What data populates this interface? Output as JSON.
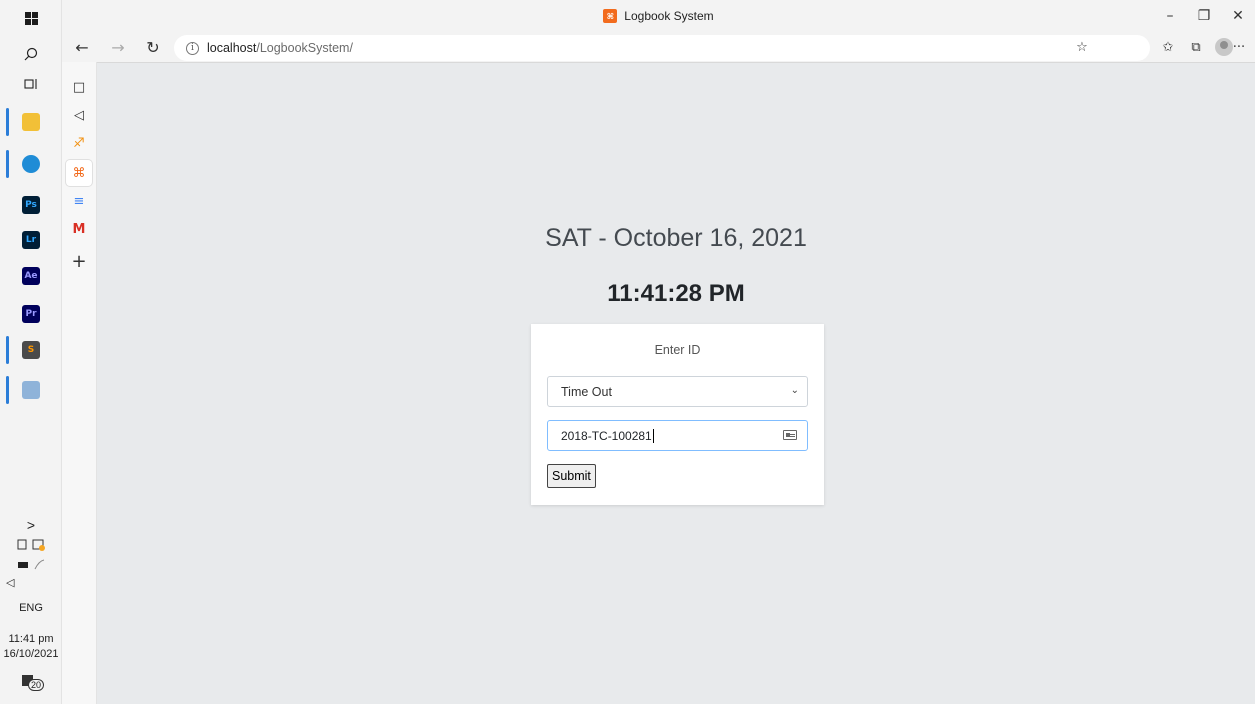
{
  "window": {
    "title": "Logbook System",
    "favicon_glyph": "⌘",
    "controls": {
      "minimize": "–",
      "restore": "❐",
      "close": "✕"
    }
  },
  "toolbar": {
    "back": "←",
    "forward": "→",
    "reload": "↻",
    "url_host": "localhost",
    "url_path": "/LogbookSystem/",
    "info": "i",
    "favorites_add": "☆",
    "favorites": "✩",
    "collections": "⧉",
    "more": "···"
  },
  "sidebar": {
    "items": [
      {
        "name": "tab-actions",
        "glyph": "□"
      },
      {
        "name": "speaker",
        "glyph": "◁"
      },
      {
        "name": "pma",
        "glyph": "♐"
      },
      {
        "name": "xampp",
        "glyph": "⌘"
      },
      {
        "name": "docs",
        "glyph": "≡"
      },
      {
        "name": "gmail",
        "glyph": "M"
      },
      {
        "name": "add",
        "glyph": "+"
      }
    ]
  },
  "taskbar": {
    "apps": [
      {
        "name": "file-explorer-icon",
        "label": "",
        "color": "#f2c037"
      },
      {
        "name": "edge-icon",
        "label": "",
        "color": "#1f8cd6"
      },
      {
        "name": "photoshop-icon",
        "label": "Ps",
        "color": "#001e36",
        "fg": "#31a8ff"
      },
      {
        "name": "lightroom-icon",
        "label": "Lr",
        "color": "#001e36",
        "fg": "#31a8ff"
      },
      {
        "name": "after-effects-icon",
        "label": "Ae",
        "color": "#00005b",
        "fg": "#9999ff"
      },
      {
        "name": "premiere-icon",
        "label": "Pr",
        "color": "#00005b",
        "fg": "#9999ff"
      },
      {
        "name": "sublime-icon",
        "label": "S",
        "color": "#4a4a4a",
        "fg": "#ff9800"
      },
      {
        "name": "generic-app-icon",
        "label": "",
        "color": "#8fb3d9"
      }
    ],
    "chevron": ">",
    "language": "ENG",
    "time": "11:41 pm",
    "date": "16/10/2021",
    "notifications": "20"
  },
  "page": {
    "date": "SAT - October 16, 2021",
    "time": "11:41:28 PM",
    "card_title": "Enter ID",
    "select_value": "Time Out",
    "id_value": "2018-TC-100281",
    "submit_label": "Submit"
  },
  "colors": {
    "page_bg": "#e8eaec",
    "input_focus": "#80bdff",
    "accent": "#2b7dd8"
  }
}
